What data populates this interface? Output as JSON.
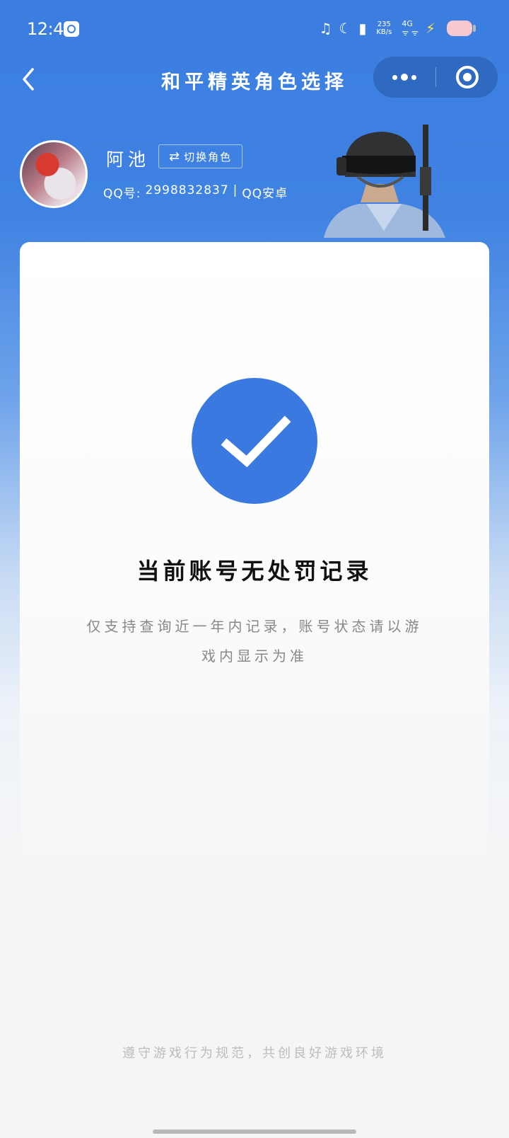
{
  "status_bar": {
    "time": "12:45",
    "net_speed_value": "235",
    "net_speed_unit": "KB/s",
    "network": "4G",
    "signal": "ᯤ ᯤ",
    "icons": [
      "music-icon",
      "moon-icon",
      "vibrate-icon",
      "signal-icon",
      "charging-icon",
      "battery-icon"
    ]
  },
  "header": {
    "title": "和平精英角色选择"
  },
  "profile": {
    "name": "阿池",
    "switch_label": "切换角色",
    "qq_label": "QQ号:",
    "qq_number": "2998832837",
    "separator": "|",
    "platform": "QQ安卓"
  },
  "result": {
    "title": "当前账号无处罚记录",
    "description": "仅支持查询近一年内记录，账号状态请以游戏内显示为准"
  },
  "footer": {
    "text": "遵守游戏行为规范，共创良好游戏环境"
  },
  "colors": {
    "primary_blue": "#3a7ae0",
    "header_blue": "#3b7ee0",
    "capsule": "#2f69c0",
    "background": "#f4f5f7"
  }
}
